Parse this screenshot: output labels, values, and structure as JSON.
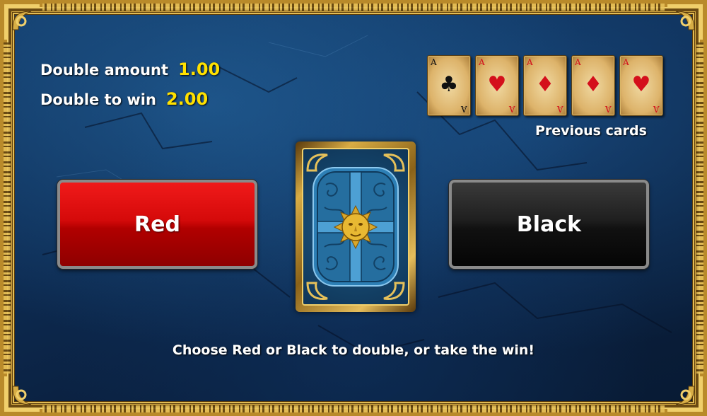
{
  "info": {
    "double_amount_label": "Double amount",
    "double_amount_value": "1.00",
    "double_to_win_label": "Double to win",
    "double_to_win_value": "2.00"
  },
  "previous_cards": {
    "label": "Previous cards",
    "cards": [
      {
        "rank": "A",
        "suit": "♣",
        "color": "black"
      },
      {
        "rank": "A",
        "suit": "♥",
        "color": "red"
      },
      {
        "rank": "A",
        "suit": "♦",
        "color": "red"
      },
      {
        "rank": "A",
        "suit": "♦",
        "color": "red"
      },
      {
        "rank": "A",
        "suit": "♥",
        "color": "red"
      }
    ]
  },
  "buttons": {
    "red_label": "Red",
    "black_label": "Black"
  },
  "hint": "Choose Red or Black to double, or take the win!",
  "colors": {
    "frame_gold": "#b98a2a",
    "value_yellow": "#ffe100",
    "red_button": "#d50a0a",
    "black_button": "#111111"
  }
}
